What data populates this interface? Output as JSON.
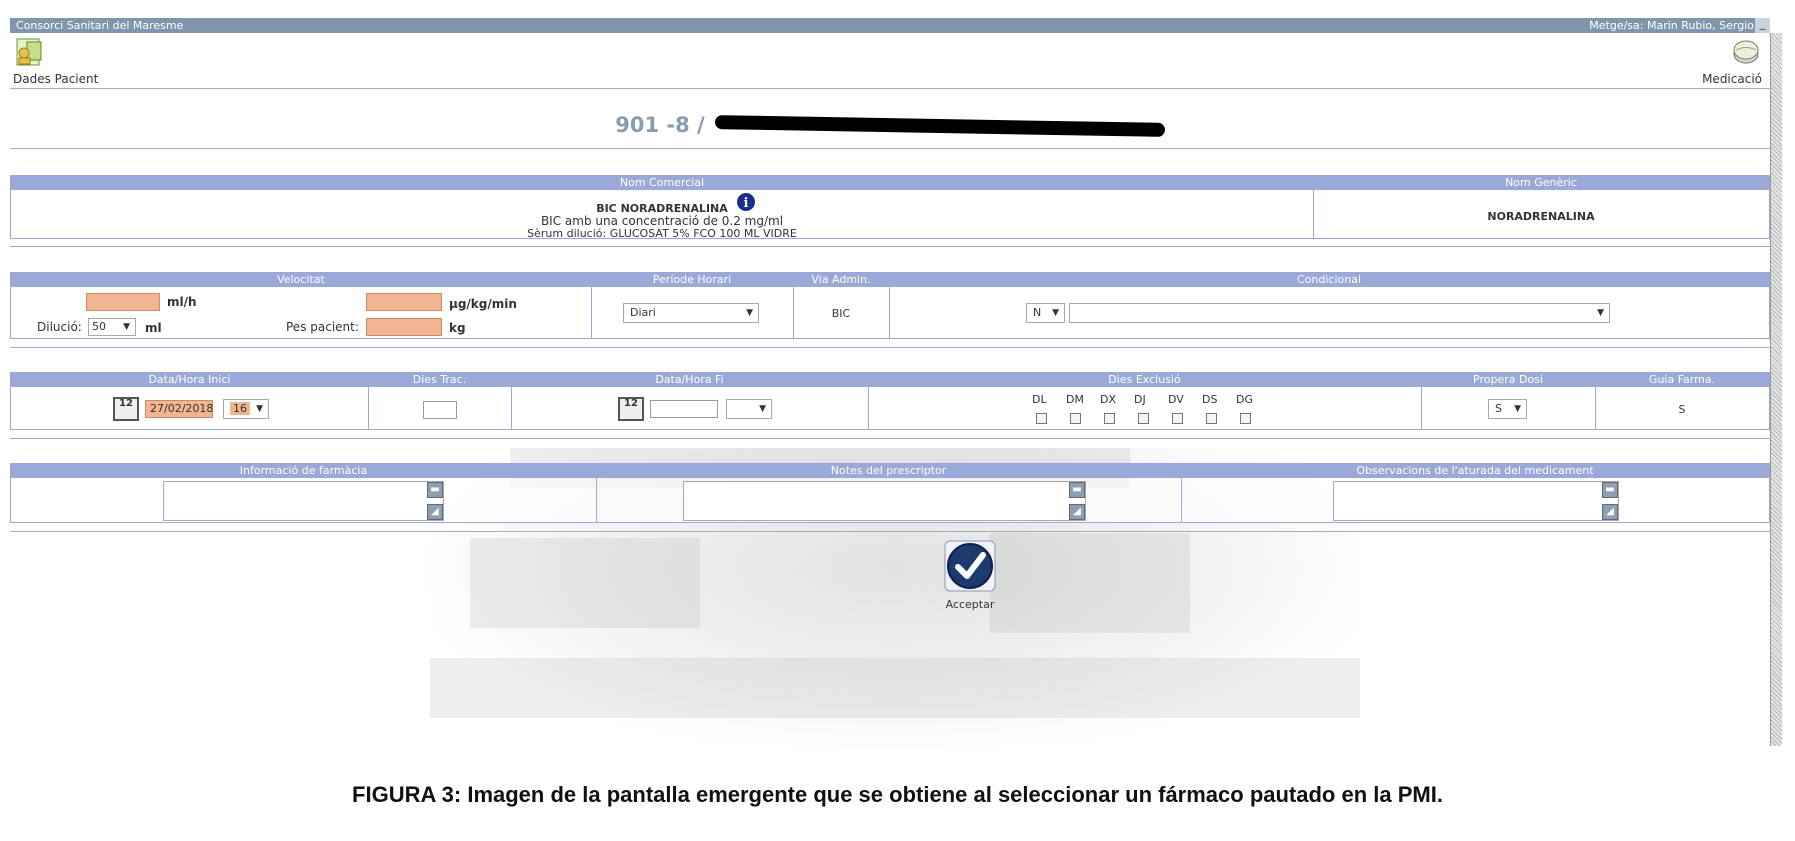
{
  "window": {
    "title": "Consorci Sanitari del Maresme",
    "user": "Metge/sa: Marin Rubio, Sergio",
    "minimize": "_"
  },
  "toolbar": {
    "patient_data": "Dades Pacient",
    "medication": "Medicació"
  },
  "patient": {
    "id": "901 -8 /"
  },
  "drug_panel": {
    "header_commercial": "Nom Comercial",
    "header_generic": "Nom Genèric",
    "commercial_line1": "BIC NORADRENALINA",
    "commercial_line2": "BIC amb una concentració de 0.2 mg/ml",
    "commercial_line3": "Sèrum dilució: GLUCOSAT 5% FCO 100 ML VIDRE",
    "generic": "NORADRENALINA",
    "info_icon": "i"
  },
  "dose_panel": {
    "header_velocity": "Velocitat",
    "header_schedule": "Període Horari",
    "header_route": "Via Admin.",
    "header_conditional": "Condicional",
    "unit_mlh": "ml/h",
    "unit_ugkgmin": "µg/kg/min",
    "dilution_label": "Dilució:",
    "dilution_value": "50",
    "dilution_unit": "ml",
    "weight_label": "Pes pacient:",
    "weight_unit": "kg",
    "schedule_value": "Diari",
    "route_value": "BIC",
    "conditional_value": "N"
  },
  "dates_panel": {
    "header_start": "Data/Hora Inici",
    "header_days": "Dies Trac.",
    "header_end": "Data/Hora Fi",
    "header_excl": "Dies Exclusió",
    "header_next": "Propera Dosi",
    "header_guide": "Guia Farma.",
    "start_date": "27/02/2018",
    "start_hour": "16",
    "calendar_glyph": "12",
    "days": [
      "DL",
      "DM",
      "DX",
      "DJ",
      "DV",
      "DS",
      "DG"
    ],
    "next_dose": "S",
    "guide": "S"
  },
  "notes_panel": {
    "header_pharmacy": "Informació de farmàcia",
    "header_prescriber": "Notes del prescriptor",
    "header_stop": "Observacions de l'aturada del medicament"
  },
  "accept": {
    "label": "Acceptar"
  },
  "caption": "FIGURA 3: Imagen de la pantalla emergente que se obtiene al seleccionar un fármaco pautado en la PMI."
}
